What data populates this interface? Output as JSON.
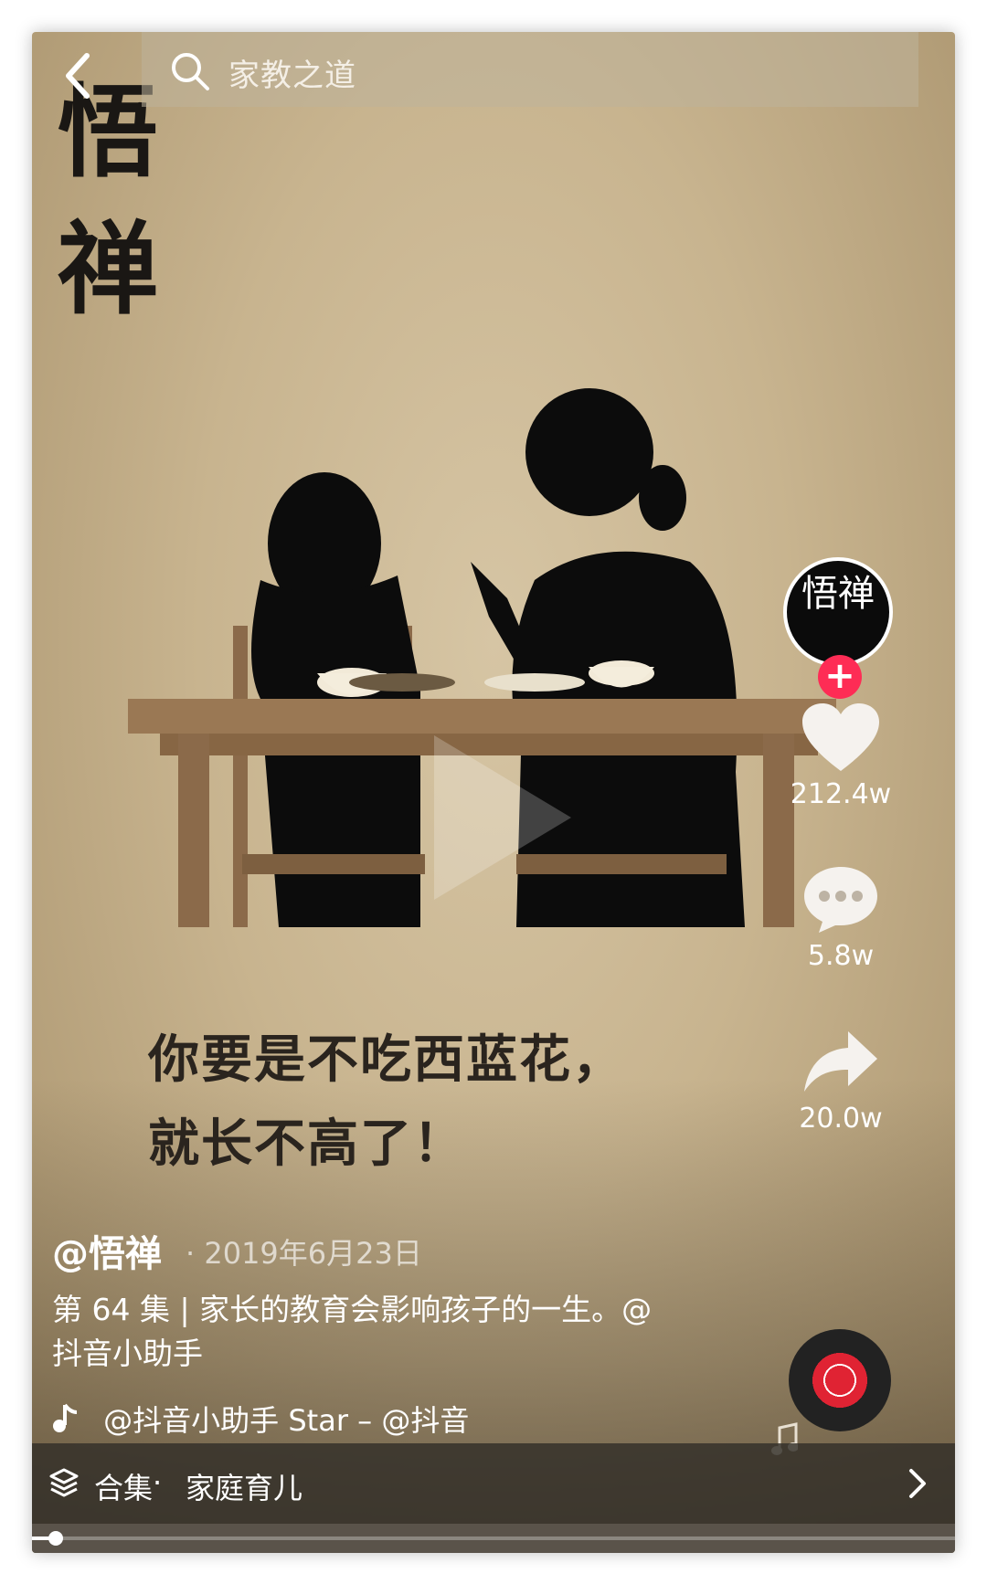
{
  "header": {
    "search_text": "家教之道"
  },
  "video": {
    "logo_text": "悟禅",
    "subtitle_lines": [
      "你要是不吃西蓝花，",
      "就长不高了！"
    ]
  },
  "post": {
    "author": "@悟禅",
    "date": "· 2019年6月23日",
    "description": "第 64 集 | 家长的教育会影响孩子的一生。@抖音小助手",
    "music": "@抖音小助手   Star – @抖音"
  },
  "sidebar": {
    "avatar_text": "悟禅",
    "follow_symbol": "+",
    "likes": "212.4w",
    "comments": "5.8w",
    "shares": "20.0w"
  },
  "collection": {
    "label": "合集",
    "separator": "·",
    "name": "家庭育儿"
  },
  "progress": {
    "fraction": 0.02
  },
  "colors": {
    "accent_red": "#fe2c55",
    "background": "#c8b48f"
  },
  "icons": [
    "back-icon",
    "search-icon",
    "play-icon",
    "heart-icon",
    "comment-icon",
    "share-icon",
    "music-disc-icon",
    "music-note-icon",
    "collection-icon",
    "chevron-right-icon"
  ]
}
